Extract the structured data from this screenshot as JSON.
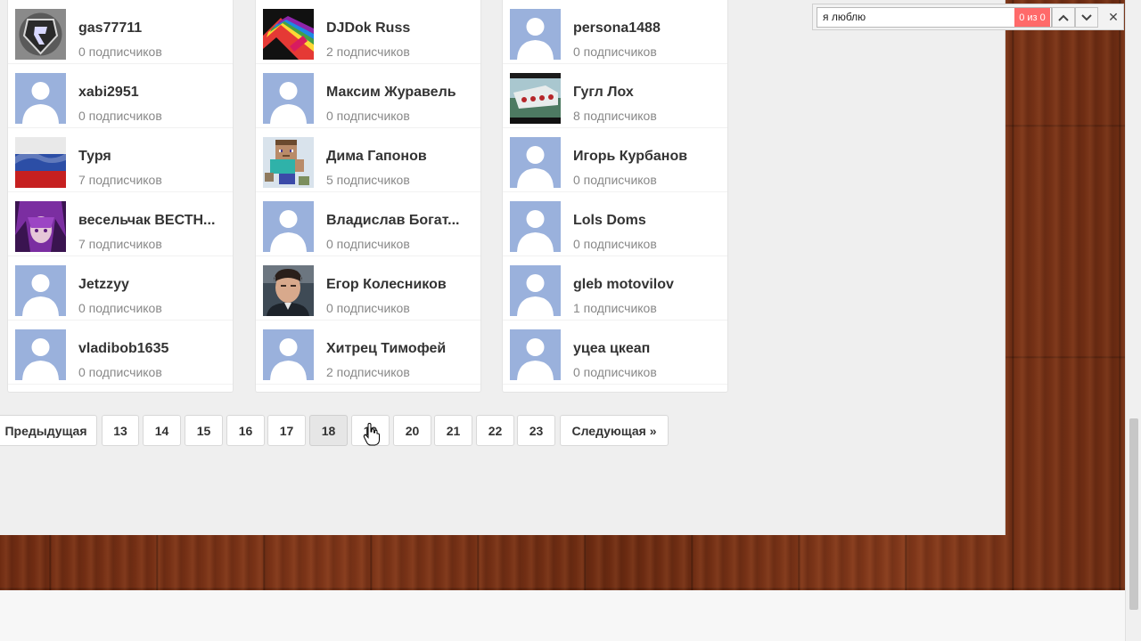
{
  "colors": {
    "default_avatar": "#9ab1dc",
    "find_count_bg": "#ff6a6a"
  },
  "find_bar": {
    "query": "я люблю",
    "count": "0 из 0",
    "prev_icon": "chevron-up-icon",
    "next_icon": "chevron-down-icon",
    "close": "✕"
  },
  "columns": [
    {
      "users": [
        {
          "name": "gas77711",
          "subs": "0 подписчиков",
          "avatar": "saints-row-logo"
        },
        {
          "name": "xabi2951",
          "subs": "0 подписчиков",
          "avatar": "default"
        },
        {
          "name": "Туря",
          "subs": "7 подписчиков",
          "avatar": "russian-flag"
        },
        {
          "name": "весельчак ВЕСТН...",
          "subs": "7 подписчиков",
          "avatar": "anime-character"
        },
        {
          "name": "Jetzzyy",
          "subs": "0 подписчиков",
          "avatar": "default"
        },
        {
          "name": "vladibob1635",
          "subs": "0 подписчиков",
          "avatar": "default"
        }
      ]
    },
    {
      "users": [
        {
          "name": "DJDok Russ",
          "subs": "2 подписчиков",
          "avatar": "rainbow-art"
        },
        {
          "name": "Максим Журавель",
          "subs": "0 подписчиков",
          "avatar": "default"
        },
        {
          "name": "Дима Гапонов",
          "subs": "5 подписчиков",
          "avatar": "minecraft-steve"
        },
        {
          "name": "Владислав Богат...",
          "subs": "0 подписчиков",
          "avatar": "default"
        },
        {
          "name": "Егор Колесников",
          "subs": "0 подписчиков",
          "avatar": "portrait-photo"
        },
        {
          "name": "Хитрец Тимофей",
          "subs": "2 подписчиков",
          "avatar": "default"
        }
      ]
    },
    {
      "users": [
        {
          "name": "persona1488",
          "subs": "0 подписчиков",
          "avatar": "default"
        },
        {
          "name": "Гугл Лох",
          "subs": "8 подписчиков",
          "avatar": "game-screenshot"
        },
        {
          "name": "Игорь Курбанов",
          "subs": "0 подписчиков",
          "avatar": "default"
        },
        {
          "name": "Lols Doms",
          "subs": "0 подписчиков",
          "avatar": "default"
        },
        {
          "name": "gleb motovilov",
          "subs": "1 подписчиков",
          "avatar": "default"
        },
        {
          "name": "уцеа цкеап",
          "subs": "0 подписчиков",
          "avatar": "default"
        }
      ]
    }
  ],
  "pagination": {
    "prev": "Предыдущая",
    "next": "Следующая »",
    "pages": [
      "13",
      "14",
      "15",
      "16",
      "17",
      "18",
      "19",
      "20",
      "21",
      "22",
      "23"
    ],
    "current": "18"
  }
}
